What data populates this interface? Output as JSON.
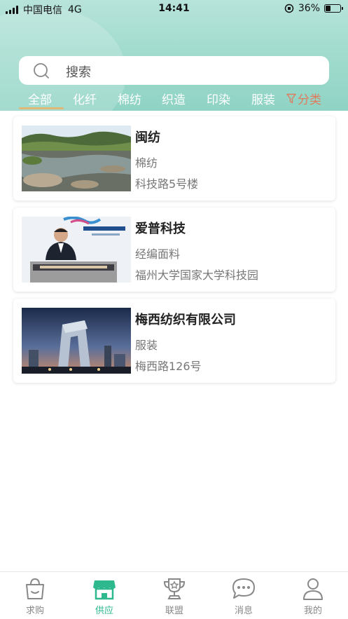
{
  "status_bar": {
    "carrier": "中国电信",
    "network": "4G",
    "time": "14:41",
    "battery": "36%",
    "battery_level": 0.36
  },
  "search": {
    "placeholder": "搜索"
  },
  "tabs": [
    {
      "label": "全部",
      "active": true
    },
    {
      "label": "化纤"
    },
    {
      "label": "棉纺"
    },
    {
      "label": "织造"
    },
    {
      "label": "印染"
    },
    {
      "label": "服装"
    }
  ],
  "category_button": {
    "label": "分类",
    "icon": "filter-icon",
    "color": "#e07c5e"
  },
  "list": [
    {
      "title": "闽纺",
      "category": "棉纺",
      "address": "科技路5号楼",
      "image": "river-landscape-photo"
    },
    {
      "title": "爱普科技",
      "category": "经编面料",
      "address": "福州大学国家大学科技园",
      "image": "summit-speaker-photo"
    },
    {
      "title": "梅西纺织有限公司",
      "category": "服装",
      "address": "梅西路126号",
      "image": "skyscraper-photo"
    }
  ],
  "tabbar": [
    {
      "label": "求购",
      "icon": "shopping-bag-icon"
    },
    {
      "label": "供应",
      "icon": "store-icon",
      "active": true
    },
    {
      "label": "联盟",
      "icon": "trophy-icon"
    },
    {
      "label": "消息",
      "icon": "chat-icon"
    },
    {
      "label": "我的",
      "icon": "user-icon"
    }
  ],
  "colors": {
    "accent": "#2db88e",
    "header": "#a2dccf",
    "tab_underline": "#e0b878"
  }
}
